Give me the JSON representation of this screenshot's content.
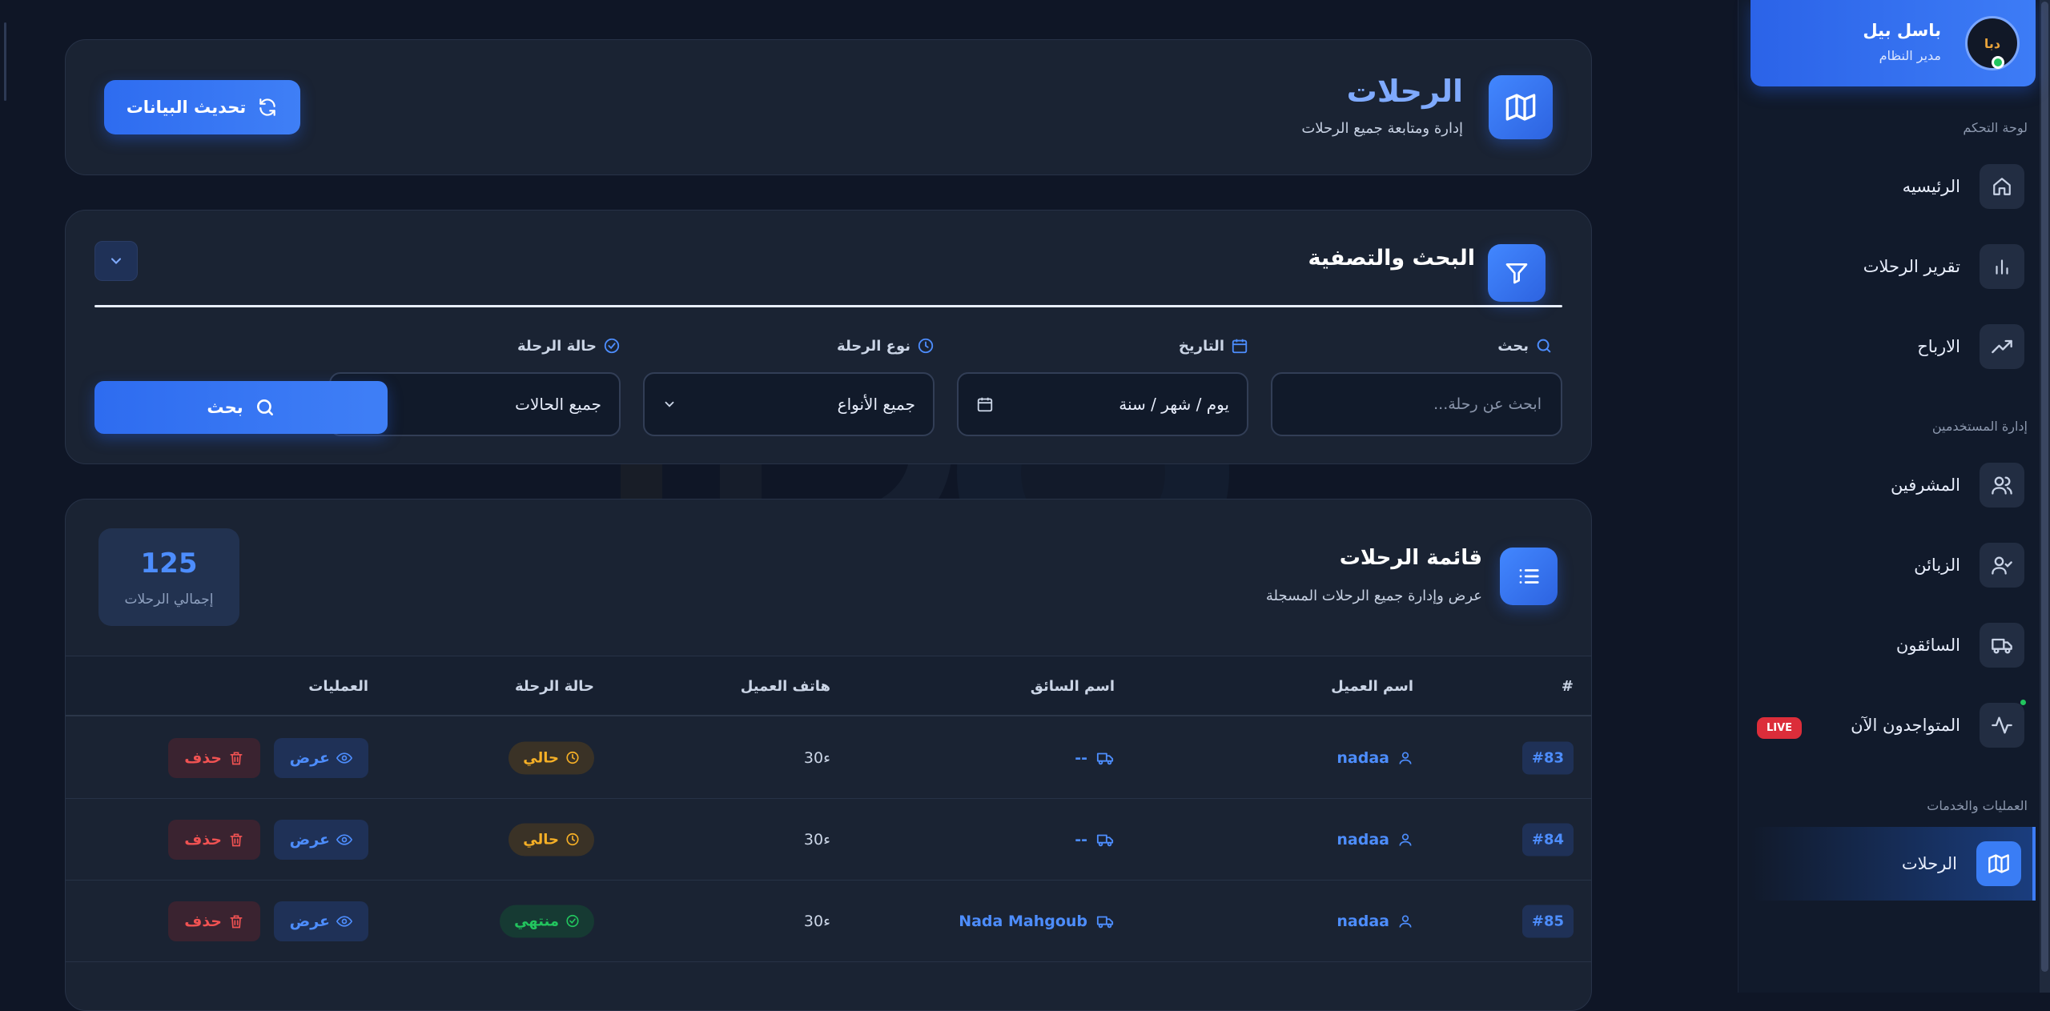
{
  "sidebar": {
    "user": {
      "name": "باسل بيل",
      "role": "مدير النظام",
      "avatar_text": "دبا"
    },
    "sections": [
      {
        "label": "لوحة التحكم",
        "items": [
          {
            "label": "الرئيسيه",
            "icon": "home-icon"
          },
          {
            "label": "تقرير الرحلات",
            "icon": "bar-chart-icon"
          },
          {
            "label": "الارباح",
            "icon": "trending-up-icon"
          }
        ]
      },
      {
        "label": "إدارة المستخدمين",
        "items": [
          {
            "label": "المشرفين",
            "icon": "users-icon"
          },
          {
            "label": "الزبائن",
            "icon": "user-check-icon"
          },
          {
            "label": "السائقون",
            "icon": "truck-icon"
          },
          {
            "label": "المتواجدون الآن",
            "icon": "activity-icon",
            "badge": "LIVE"
          }
        ]
      },
      {
        "label": "العمليات والخدمات",
        "items": [
          {
            "label": "الرحلات",
            "icon": "map-icon",
            "active": true
          }
        ]
      }
    ]
  },
  "header": {
    "title": "الرحلات",
    "subtitle": "إدارة ومتابعة جميع الرحلات",
    "refresh_label": "تحديث البيانات"
  },
  "filters": {
    "title": "البحث والتصفية",
    "search_label": "بحث",
    "search_placeholder": "ابحث عن رحلة...",
    "date_label": "التاريخ",
    "date_value": "يوم / شهر / سنة",
    "type_label": "نوع الرحلة",
    "type_value": "جميع الأنواع",
    "status_label": "حالة الرحلة",
    "status_value": "جميع الحالات",
    "search_button": "بحث"
  },
  "trips": {
    "title": "قائمة الرحلات",
    "subtitle": "عرض وإدارة جميع الرحلات المسجلة",
    "total_value": "125",
    "total_label": "إجمالي الرحلات",
    "columns": {
      "id": "#",
      "client": "اسم العميل",
      "driver": "اسم السائق",
      "phone": "هاتف العميل",
      "status": "حالة الرحلة",
      "actions": "العمليات"
    },
    "view_label": "عرض",
    "delete_label": "حذف",
    "rows": [
      {
        "id": "#83",
        "client": "nadaa",
        "driver": "--",
        "phone": "30ء",
        "status": "حالي",
        "status_kind": "current"
      },
      {
        "id": "#84",
        "client": "nadaa",
        "driver": "--",
        "phone": "30ء",
        "status": "حالي",
        "status_kind": "current"
      },
      {
        "id": "#85",
        "client": "nadaa",
        "driver": "Nada Mahgoub",
        "phone": "30ء",
        "status": "منتهي",
        "status_kind": "done"
      }
    ]
  },
  "colors": {
    "accent": "#3c7cf6",
    "background": "#0f1626",
    "panel": "#1a2333",
    "status_current": "#f6b026",
    "status_done": "#22c55e",
    "danger": "#f05252"
  }
}
